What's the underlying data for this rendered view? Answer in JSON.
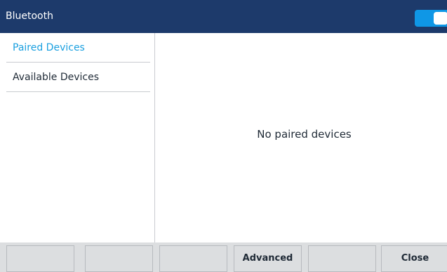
{
  "header": {
    "title": "Bluetooth",
    "bluetooth_enabled": true
  },
  "sidebar": {
    "items": [
      {
        "label": "Paired Devices",
        "active": true
      },
      {
        "label": "Available Devices",
        "active": false
      }
    ]
  },
  "main": {
    "empty_message": "No paired devices"
  },
  "softkeys": [
    {
      "label": ""
    },
    {
      "label": ""
    },
    {
      "label": ""
    },
    {
      "label": "Advanced"
    },
    {
      "label": ""
    },
    {
      "label": "Close"
    }
  ],
  "colors": {
    "header_bg": "#1d3a6b",
    "accent": "#1aa0e0",
    "toggle_on": "#0f97e6",
    "softkey_bg": "#dcdee0"
  }
}
